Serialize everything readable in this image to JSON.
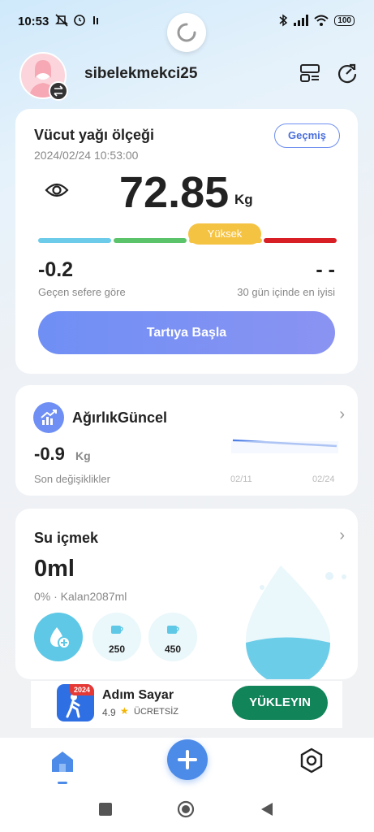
{
  "status_bar": {
    "time": "10:53",
    "battery": "100"
  },
  "header": {
    "username": "sibelekmekci25"
  },
  "body_fat_card": {
    "title": "Vücut yağı ölçeği",
    "history_button": "Geçmiş",
    "datetime": "2024/02/24 10:53:00",
    "value": "72.85",
    "unit": "Kg",
    "level": "Yüksek",
    "change_value": "-0.2",
    "change_label": "Geçen sefere göre",
    "best_value": "- -",
    "best_label": "30 gün içinde en iyisi",
    "start_button": "Tartıya Başla",
    "scale_colors": [
      "#6ccbe9",
      "#5bc46a",
      "#f5c342",
      "#d81f26"
    ]
  },
  "weight_card": {
    "title": "AğırlıkGüncel",
    "change_value": "-0.9",
    "unit": "Kg",
    "change_label": "Son değişiklikler",
    "chart_x_start": "02/11",
    "chart_x_end": "02/24"
  },
  "water_card": {
    "title": "Su içmek",
    "amount": "0ml",
    "summary": "0% · Kalan2087ml",
    "quick_add": [
      "250",
      "450"
    ]
  },
  "ad": {
    "app_name": "Adım Sayar",
    "rating": "4.9",
    "price": "ÜCRETSİZ",
    "badge": "2024",
    "install_button": "YÜKLEYIN"
  },
  "colors": {
    "accent": "#6f8ff5",
    "water": "#5ec8e6",
    "install": "#12845a"
  }
}
